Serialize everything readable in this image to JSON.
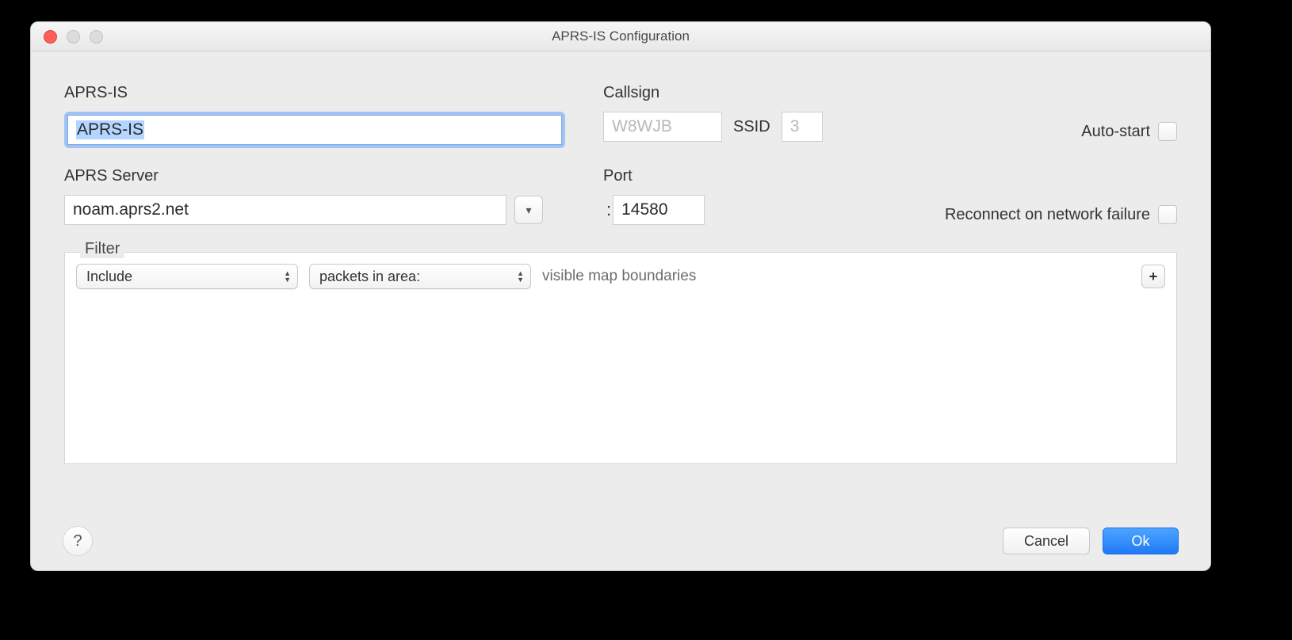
{
  "window_title": "APRS-IS Configuration",
  "section1": {
    "aprs_label": "APRS-IS",
    "aprs_value": "APRS-IS",
    "callsign_label": "Callsign",
    "callsign_placeholder": "W8WJB",
    "ssid_label": "SSID",
    "ssid_placeholder": "3",
    "autostart_label": "Auto-start"
  },
  "section2": {
    "server_label": "APRS Server",
    "server_value": "noam.aprs2.net",
    "port_label": "Port",
    "port_value": "14580",
    "reconnect_label": "Reconnect  on network failure"
  },
  "filter": {
    "legend": "Filter",
    "mode": "Include",
    "criteria": "packets in area:",
    "description": "visible map boundaries"
  },
  "buttons": {
    "cancel": "Cancel",
    "ok": "Ok"
  }
}
